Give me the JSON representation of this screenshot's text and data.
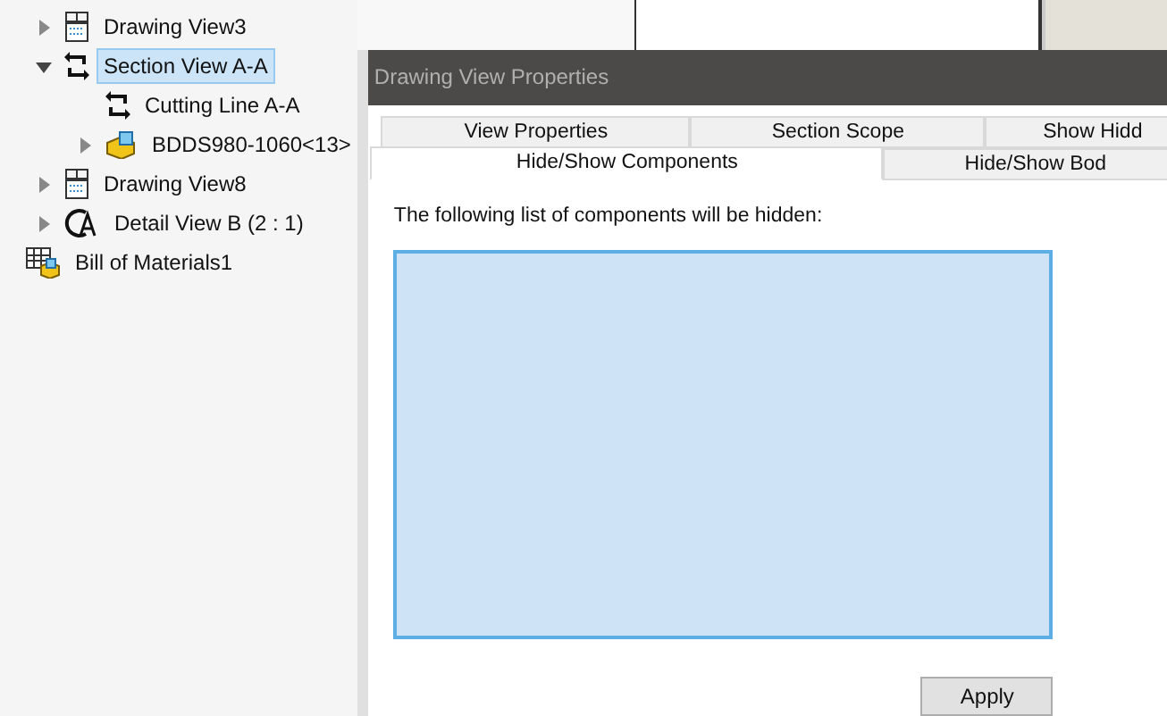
{
  "tree": [
    {
      "label": "Drawing View3",
      "kind": "drawing-view",
      "expanded": false,
      "selected": false
    },
    {
      "label": "Section View A-A",
      "kind": "section-view",
      "expanded": true,
      "selected": true,
      "children": [
        {
          "label": "Cutting Line A-A",
          "kind": "cutting-line",
          "selected": false
        },
        {
          "label": "BDDS980-1060<13>",
          "kind": "part",
          "expanded": false,
          "selected": false
        }
      ]
    },
    {
      "label": "Drawing View8",
      "kind": "drawing-view",
      "expanded": false,
      "selected": false
    },
    {
      "label": "Detail View B (2 : 1)",
      "kind": "detail-view",
      "expanded": false,
      "selected": false
    },
    {
      "label": "Bill of Materials1",
      "kind": "bom",
      "selected": false
    }
  ],
  "dialog": {
    "title": "Drawing View Properties",
    "tab_rows": [
      [
        {
          "label": "View Properties",
          "selected": false
        },
        {
          "label": "Section Scope",
          "selected": false
        },
        {
          "label": "Show Hidd",
          "selected": false
        }
      ],
      [
        {
          "label": "Hide/Show Components",
          "selected": true
        },
        {
          "label": "Hide/Show Bod",
          "selected": false
        }
      ]
    ],
    "caption": "The following list of components will be hidden:",
    "apply_button": "Apply"
  }
}
